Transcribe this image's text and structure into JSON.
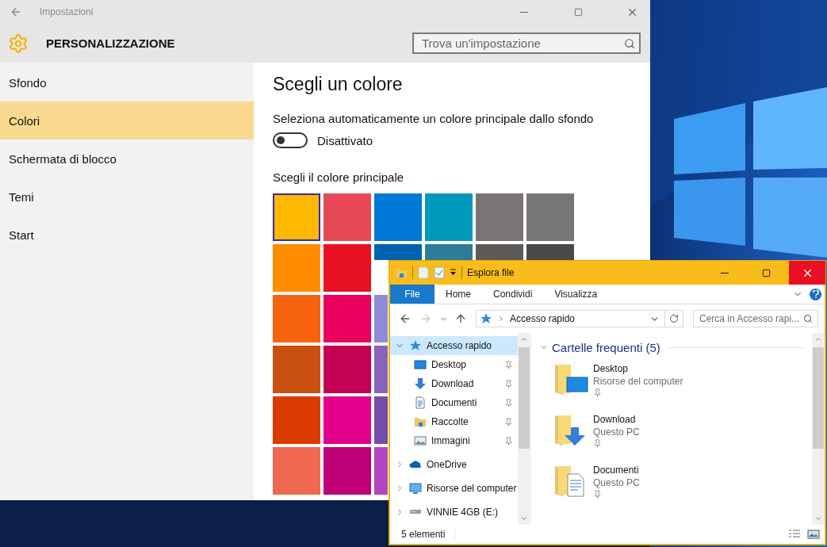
{
  "settings": {
    "title": "Impostazioni",
    "header": "PERSONALIZZAZIONE",
    "search_placeholder": "Trova un'impostazione",
    "nav": [
      {
        "label": "Sfondo",
        "selected": false
      },
      {
        "label": "Colori",
        "selected": true
      },
      {
        "label": "Schermata di blocco",
        "selected": false
      },
      {
        "label": "Temi",
        "selected": false
      },
      {
        "label": "Start",
        "selected": false
      }
    ],
    "heading": "Scegli un colore",
    "auto_color": {
      "label": "Seleziona automaticamente un colore principale dallo sfondo",
      "on": false,
      "state_text": "Disattivato"
    },
    "palette_label": "Scegli il colore principale",
    "swatches": [
      [
        {
          "color": "#ffb900",
          "selected": true
        },
        {
          "color": "#e74856",
          "selected": false
        },
        {
          "color": "#0078d7",
          "selected": false
        },
        {
          "color": "#0099bc",
          "selected": false
        },
        {
          "color": "#7a7574",
          "selected": false
        },
        {
          "color": "#767676",
          "selected": false
        }
      ],
      [
        {
          "color": "#ff8c00",
          "selected": false
        },
        {
          "color": "#e81123",
          "selected": false
        },
        {
          "color": "#0063b1",
          "selected": false
        },
        {
          "color": "#2d7d9a",
          "selected": false
        },
        {
          "color": "#5d5a58",
          "selected": false
        },
        {
          "color": "#4c4a48",
          "selected": false
        }
      ],
      [
        {
          "color": "#f7630c",
          "selected": false
        },
        {
          "color": "#ea005e",
          "selected": false
        },
        {
          "color": "#8e8cd8",
          "selected": false
        }
      ],
      [
        {
          "color": "#ca5010",
          "selected": false
        },
        {
          "color": "#c30052",
          "selected": false
        },
        {
          "color": "#8764b8",
          "selected": false
        }
      ],
      [
        {
          "color": "#da3b01",
          "selected": false
        },
        {
          "color": "#e3008c",
          "selected": false
        },
        {
          "color": "#744da9",
          "selected": false
        }
      ],
      [
        {
          "color": "#ef6950",
          "selected": false
        },
        {
          "color": "#bf0077",
          "selected": false
        },
        {
          "color": "#b146c2",
          "selected": false
        }
      ]
    ]
  },
  "explorer": {
    "title": "Esplora file",
    "ribbon_tabs": [
      {
        "label": "File",
        "kind": "menu"
      },
      {
        "label": "Home",
        "kind": "tab"
      },
      {
        "label": "Condividi",
        "kind": "tab"
      },
      {
        "label": "Visualizza",
        "kind": "tab"
      }
    ],
    "nav_buttons": [
      {
        "kind": "back",
        "disabled": false
      },
      {
        "kind": "forward",
        "disabled": true
      },
      {
        "kind": "recent",
        "disabled": false
      },
      {
        "kind": "up",
        "disabled": false
      }
    ],
    "address": "Accesso rapido",
    "search_placeholder": "Cerca in Accesso rapi...",
    "nav_tree": [
      {
        "label": "Accesso rapido",
        "kind": "quick",
        "expanded": true,
        "selected": true,
        "children": [
          {
            "label": "Desktop",
            "kind": "desktop",
            "pinned": true
          },
          {
            "label": "Download",
            "kind": "download",
            "pinned": true
          },
          {
            "label": "Documenti",
            "kind": "documents",
            "pinned": true
          },
          {
            "label": "Raccolte",
            "kind": "library",
            "pinned": true
          },
          {
            "label": "Immagini",
            "kind": "pictures",
            "pinned": true
          }
        ]
      },
      {
        "label": "OneDrive",
        "kind": "cloud",
        "expanded": false,
        "selected": false
      },
      {
        "label": "Risorse del computer",
        "kind": "computer",
        "expanded": false,
        "selected": false
      },
      {
        "label": "VINNIE 4GB (E:)",
        "kind": "drive",
        "expanded": false,
        "selected": false
      }
    ],
    "group": {
      "title": "Cartelle frequenti (5)",
      "expanded": true
    },
    "items": [
      {
        "name": "Desktop",
        "location": "Risorse del computer",
        "kind": "desktop",
        "pinned": true
      },
      {
        "name": "Download",
        "location": "Questo PC",
        "kind": "download",
        "pinned": true
      },
      {
        "name": "Documenti",
        "location": "Questo PC",
        "kind": "documents",
        "pinned": true
      }
    ],
    "status": "5 elementi"
  }
}
